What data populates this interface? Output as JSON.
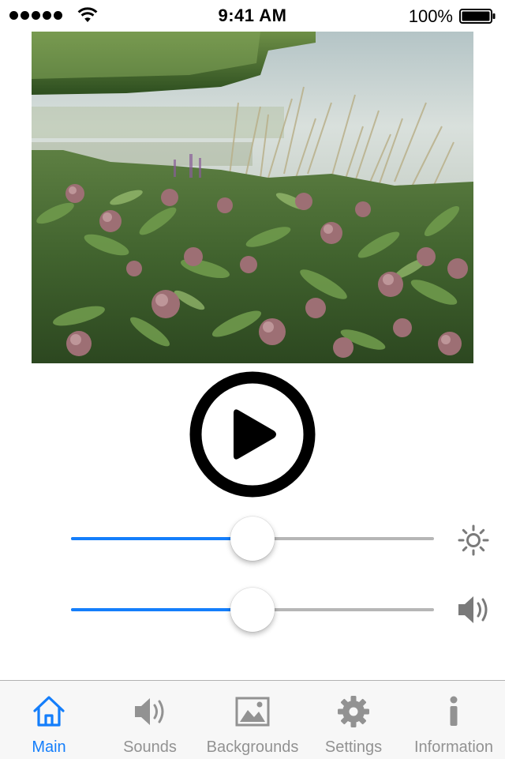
{
  "status_bar": {
    "time": "9:41 AM",
    "battery": "100%"
  },
  "photo": {
    "subject": "Pink milkweed flowers along a lake shore"
  },
  "player": {
    "play_icon": "play-icon"
  },
  "controls": {
    "brightness": {
      "value": 0.5,
      "icon": "brightness-icon"
    },
    "volume": {
      "value": 0.5,
      "icon": "speaker-icon"
    }
  },
  "tabs": [
    {
      "label": "Main",
      "icon": "home-icon",
      "active": true
    },
    {
      "label": "Sounds",
      "icon": "speaker-icon",
      "active": false
    },
    {
      "label": "Backgrounds",
      "icon": "picture-icon",
      "active": false
    },
    {
      "label": "Settings",
      "icon": "gear-icon",
      "active": false
    },
    {
      "label": "Information",
      "icon": "info-icon",
      "active": false
    }
  ],
  "colors": {
    "accent": "#147efb",
    "inactive": "#929292",
    "track": "#b6b6b6",
    "tab_bar_bg": "#f7f7f7"
  }
}
